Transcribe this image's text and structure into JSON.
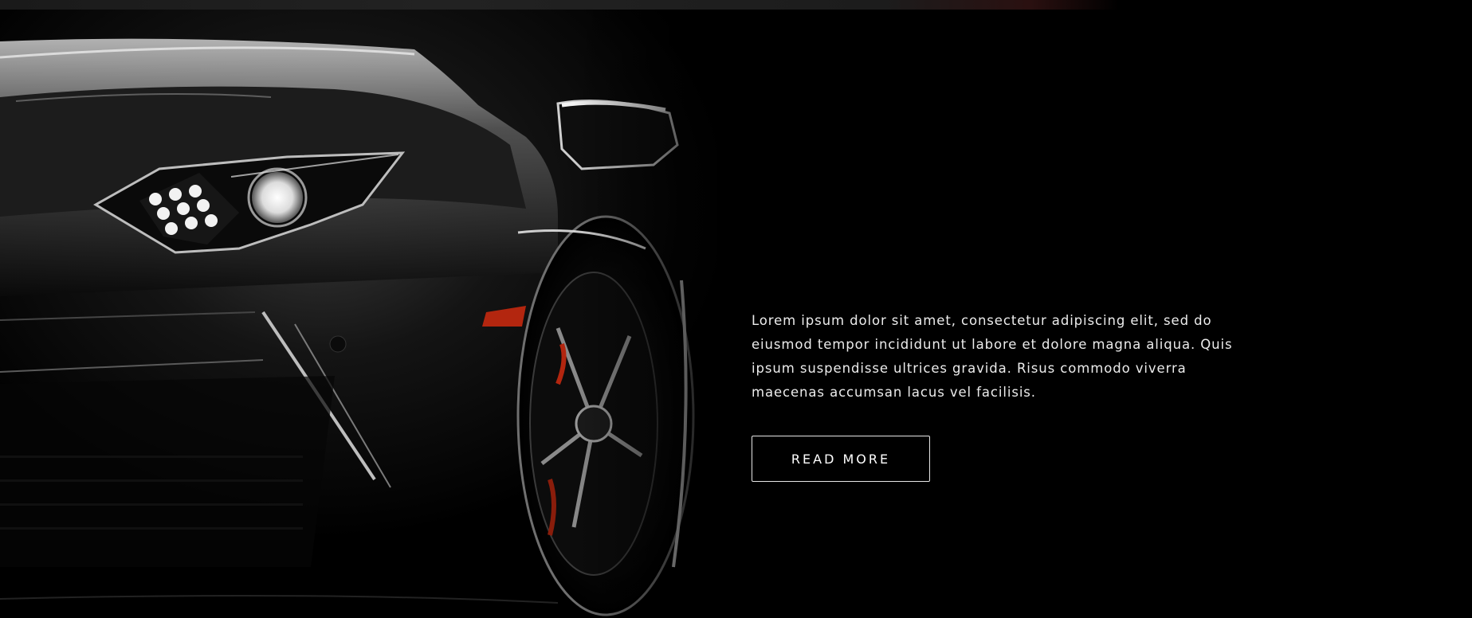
{
  "hero": {
    "image_subject": "sports-car-front-headlight",
    "description_paragraph": "Lorem ipsum dolor sit amet, consectetur adipiscing elit, sed do eiusmod tempor incididunt ut labore et dolore magna aliqua. Quis ipsum suspendisse ultrices gravida. Risus commodo viverra maecenas accumsan lacus vel facilisis.",
    "button_label": "READ MORE"
  },
  "colors": {
    "background": "#000000",
    "text": "#ececec",
    "button_border": "#e6e6e6",
    "accent_red": "#b3260f"
  }
}
